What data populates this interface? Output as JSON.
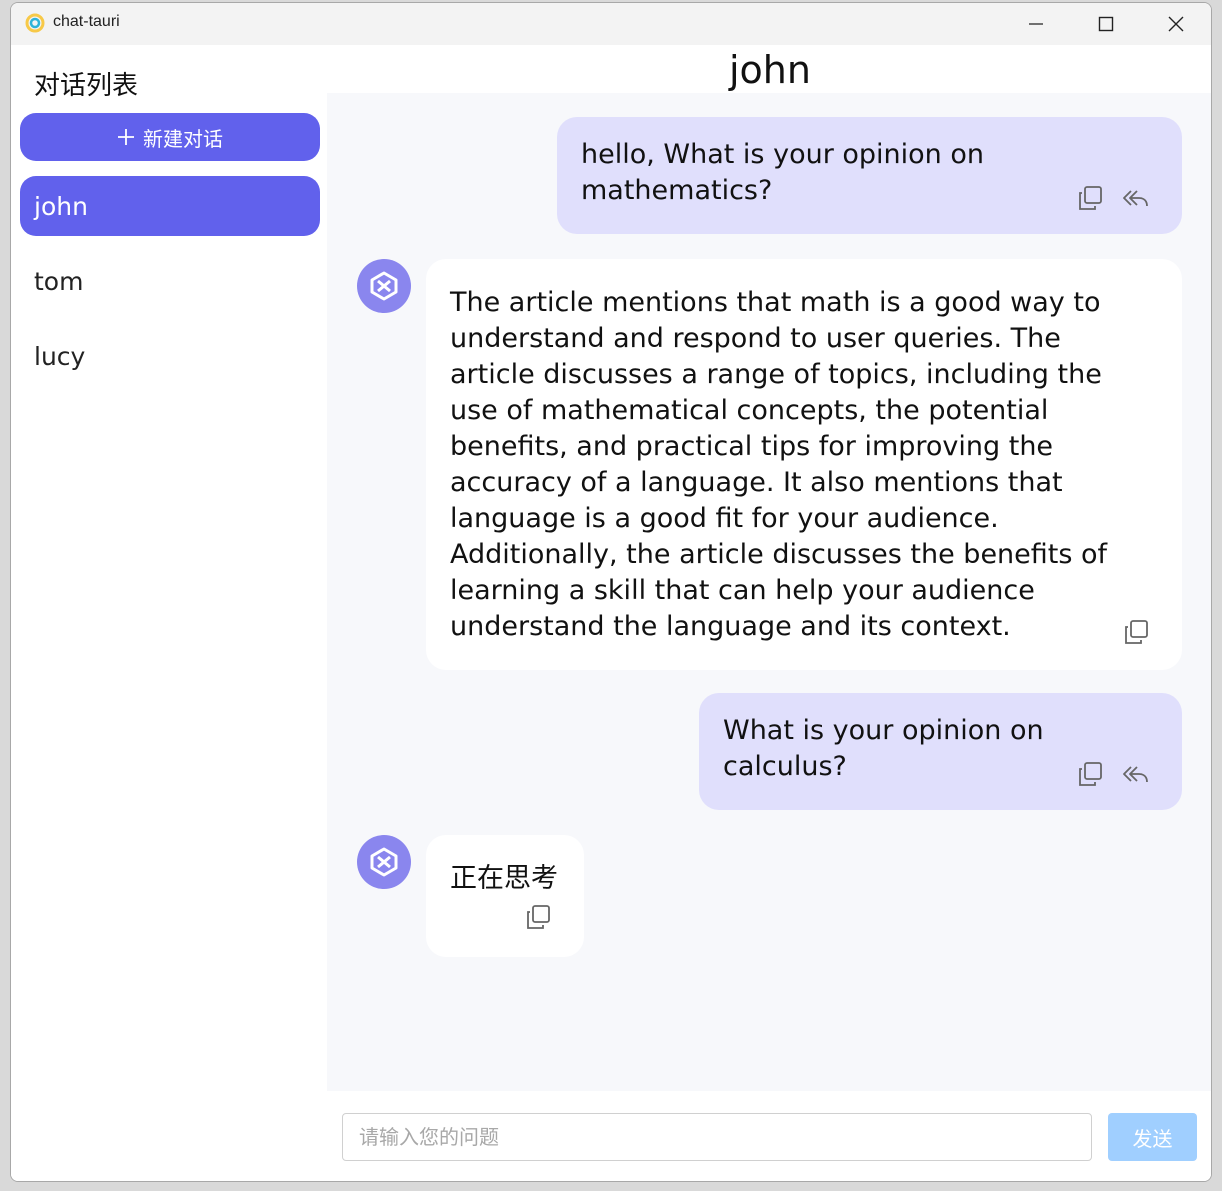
{
  "window": {
    "title": "chat-tauri"
  },
  "sidebar": {
    "title": "对话列表",
    "new_chat_label": "新建对话",
    "conversations": [
      {
        "name": "john",
        "active": true
      },
      {
        "name": "tom",
        "active": false
      },
      {
        "name": "lucy",
        "active": false
      }
    ]
  },
  "chat": {
    "title": "john",
    "messages": [
      {
        "role": "user",
        "text": "hello, What is your opinion on mathematics?"
      },
      {
        "role": "assistant",
        "text": "The article mentions that math is a good way to understand and respond to user queries. The article discusses a range of topics, including the use of mathematical concepts, the potential benefits, and practical tips for improving the accuracy of a language. It also mentions that language is a good fit for your audience. Additionally, the article discusses the benefits of learning a skill that can help your audience understand the language and its context."
      },
      {
        "role": "user",
        "text": "What is your opinion on calculus?"
      },
      {
        "role": "assistant",
        "text": "正在思考"
      }
    ]
  },
  "input": {
    "placeholder": "请输入您的问题",
    "value": ""
  },
  "send_label": "发送",
  "colors": {
    "accent": "#6161ec",
    "user_bubble": "#e0dffc",
    "send_disabled": "#a0cfff",
    "avatar": "#8a86ee"
  }
}
